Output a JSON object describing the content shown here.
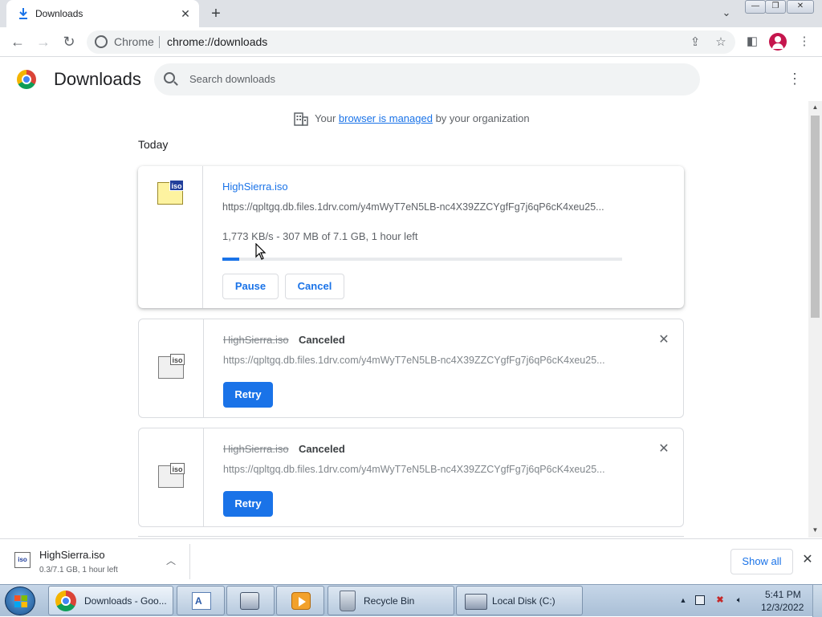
{
  "tab": {
    "title": "Downloads",
    "close": "✕"
  },
  "newtab": "+",
  "window": {
    "minimize": "—",
    "restore": "❐",
    "close": "✕"
  },
  "omnibox": {
    "chip": "Chrome",
    "url": "chrome://downloads"
  },
  "page": {
    "title": "Downloads",
    "search_placeholder": "Search downloads"
  },
  "managed": {
    "prefix": "Your ",
    "link": "browser is managed",
    "suffix": " by your organization"
  },
  "section": "Today",
  "downloads": [
    {
      "filename": "HighSierra.iso",
      "url": "https://qpltgq.db.files.1drv.com/y4mWyT7eN5LB-nc4X39ZZCYgfFg7j6qP6cK4xeu25...",
      "progress_text": "1,773 KB/s - 307 MB of 7.1 GB, 1 hour left",
      "progress_fraction": 0.042,
      "buttons": [
        "Pause",
        "Cancel"
      ],
      "icon_label": "iso"
    },
    {
      "filename": "HighSierra.iso",
      "status": "Canceled",
      "url": "https://qpltgq.db.files.1drv.com/y4mWyT7eN5LB-nc4X39ZZCYgfFg7j6qP6cK4xeu25...",
      "button": "Retry",
      "icon_label": "iso"
    },
    {
      "filename": "HighSierra.iso",
      "status": "Canceled",
      "url": "https://qpltgq.db.files.1drv.com/y4mWyT7eN5LB-nc4X39ZZCYgfFg7j6qP6cK4xeu25...",
      "button": "Retry",
      "icon_label": "iso"
    }
  ],
  "shelf": {
    "filename": "HighSierra.iso",
    "subtitle": "0.3/7.1 GB, 1 hour left",
    "icon_label": "iso",
    "show_all": "Show all"
  },
  "taskbar": {
    "items": [
      {
        "label": "Downloads - Goo...",
        "icon": "chrome-icon"
      },
      {
        "label": "",
        "icon": "wordpad-icon"
      },
      {
        "label": "",
        "icon": "keyboard-icon"
      },
      {
        "label": "",
        "icon": "media-player-icon"
      },
      {
        "label": "Recycle Bin",
        "icon": "recycle-bin-icon"
      },
      {
        "label": "Local Disk (C:)",
        "icon": "explorer-icon"
      }
    ],
    "time": "5:41 PM",
    "date": "12/3/2022"
  },
  "colors": {
    "accent": "#1a73e8",
    "progress": "#1a73e8"
  }
}
